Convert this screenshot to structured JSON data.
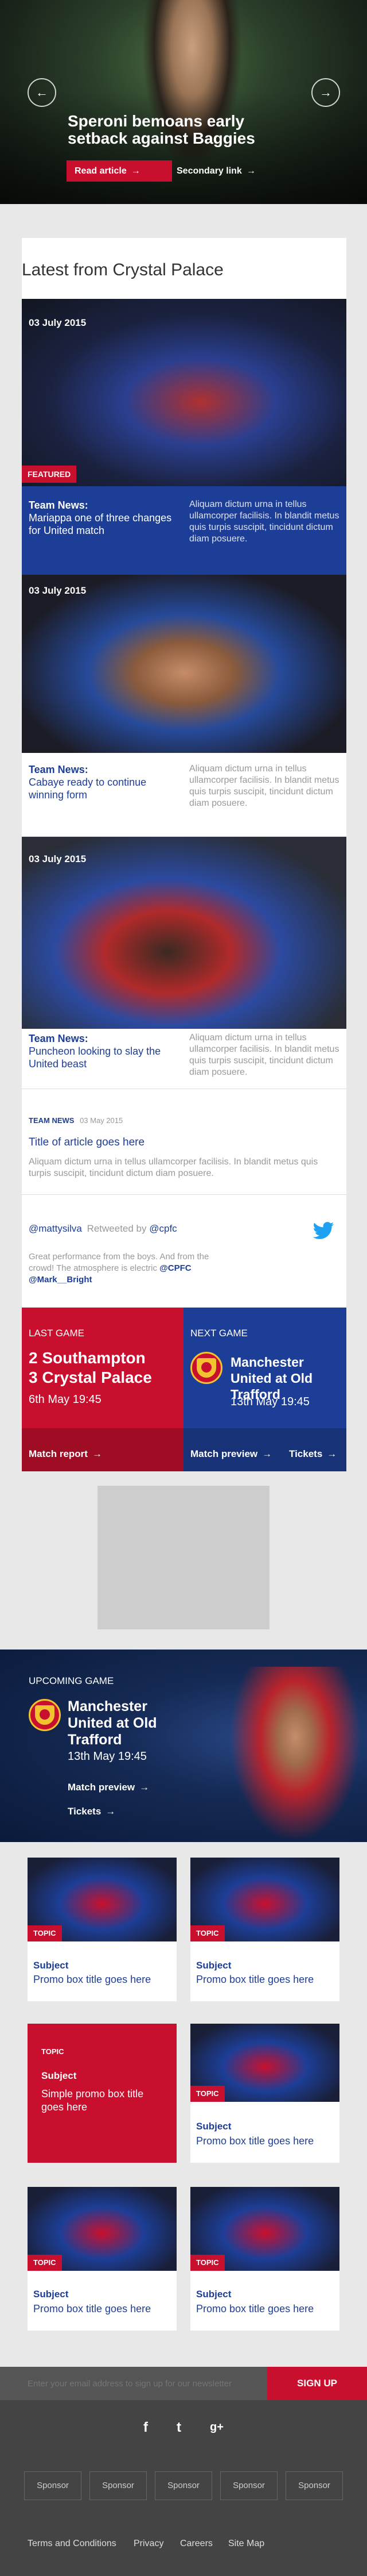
{
  "hero": {
    "title": "Speroni bemoans early setback against Baggies",
    "read_article": "Read article",
    "secondary_link": "Secondary link"
  },
  "latest": {
    "title": "Latest from Crystal Palace",
    "cards": [
      {
        "date": "03 July 2015",
        "tag": "FEATURED",
        "kicker": "Team News:",
        "headline": "Mariappa one of three changes for United match",
        "body": "Aliquam dictum urna in tellus ullamcorper facilisis. In blandit metus quis turpis suscipit, tincidunt dictum diam posuere."
      },
      {
        "date": "03 July 2015",
        "kicker": "Team News:",
        "headline": "Cabaye ready to continue winning form",
        "body": "Aliquam dictum urna in tellus ullamcorper facilisis. In blandit metus quis turpis suscipit, tincidunt dictum diam posuere."
      },
      {
        "date": "03 July 2015",
        "kicker": "Team News:",
        "headline": "Puncheon looking to slay the United beast",
        "body": "Aliquam dictum urna in tellus ullamcorper facilisis. In blandit metus quis turpis suscipit, tincidunt dictum diam posuere."
      }
    ],
    "text_article": {
      "kicker": "TEAM NEWS",
      "date": "03 May 2015",
      "title": "Title of article goes here",
      "body": "Aliquam dictum urna in tellus ullamcorper facilisis. In blandit metus quis turpis suscipit, tincidunt dictum diam posuere."
    },
    "tweet": {
      "handle": "@mattysilva",
      "retweeted_by": "Retweeted by",
      "retweeter": "@cpfc",
      "text": "Great performance from the boys. And from the crowd! The atmosphere is electric",
      "tag1": "@CPFC",
      "tag2": "@Mark__Bright"
    }
  },
  "fixtures": {
    "last": {
      "label": "LAST GAME",
      "line1": "2 Southampton",
      "line2": "3 Crystal Palace",
      "date": "6th May 19:45",
      "link": "Match report"
    },
    "next": {
      "label": "NEXT GAME",
      "team": "Manchester United at Old Trafford",
      "date": "13th May 19:45",
      "link1": "Match preview",
      "link2": "Tickets"
    }
  },
  "upcoming": {
    "label": "UPCOMING GAME",
    "team": "Manchester United at Old Trafford",
    "date": "13th May 19:45",
    "link1": "Match preview",
    "link2": "Tickets"
  },
  "promos": [
    {
      "tag": "TOPIC",
      "subject": "Subject",
      "text": "Promo box title goes here"
    },
    {
      "tag": "TOPIC",
      "subject": "Subject",
      "text": "Promo box title goes here"
    },
    {
      "tag": "TOPIC",
      "subject": "Subject",
      "text": "Simple promo box title goes here"
    },
    {
      "tag": "TOPIC",
      "subject": "Subject",
      "text": "Promo box title goes here"
    },
    {
      "tag": "TOPIC",
      "subject": "Subject",
      "text": "Promo box title goes here"
    },
    {
      "tag": "TOPIC",
      "subject": "Subject",
      "text": "Promo box title goes here"
    }
  ],
  "newsletter": {
    "placeholder": "Enter your email address to sign up for our newsletter",
    "button": "SIGN UP"
  },
  "social": {
    "facebook": "f",
    "twitter": "t",
    "google": "g+"
  },
  "sponsors": [
    "Sponsor",
    "Sponsor",
    "Sponsor",
    "Sponsor",
    "Sponsor"
  ],
  "footer_links": [
    "Terms and Conditions",
    "Privacy",
    "Careers",
    "Site Map"
  ],
  "colors": {
    "accent_red": "#c8102e",
    "brand_blue": "#1d3e96",
    "twitter_blue": "#1da1f2"
  }
}
